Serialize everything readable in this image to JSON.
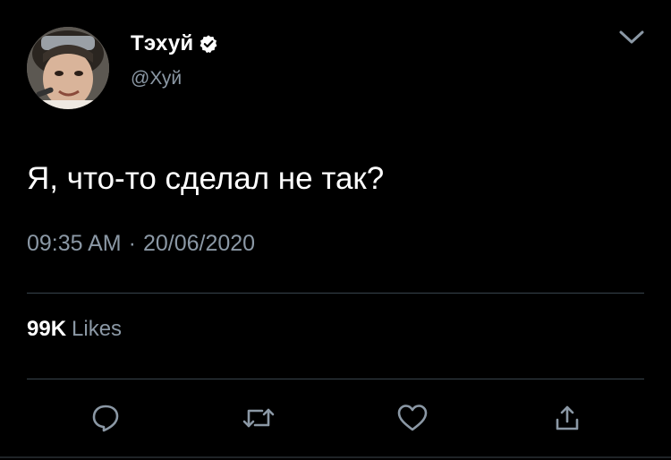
{
  "author": {
    "display_name": "Тэхуй",
    "handle": "@Хуй",
    "verified": true
  },
  "tweet": {
    "text": "Я, что-то сделал не так?",
    "time": "09:35 AM",
    "separator": "·",
    "date": "20/06/2020"
  },
  "stats": {
    "likes_count": "99K",
    "likes_label": "Likes"
  },
  "icons": {
    "menu": "chevron-down-icon",
    "reply": "reply-icon",
    "retweet": "retweet-icon",
    "like": "heart-icon",
    "share": "share-icon",
    "verified": "verified-badge-icon"
  },
  "colors": {
    "background": "#000000",
    "text_primary": "#ffffff",
    "text_secondary": "#8b98a5",
    "divider": "#38444d",
    "icon": "#8b98a5"
  }
}
